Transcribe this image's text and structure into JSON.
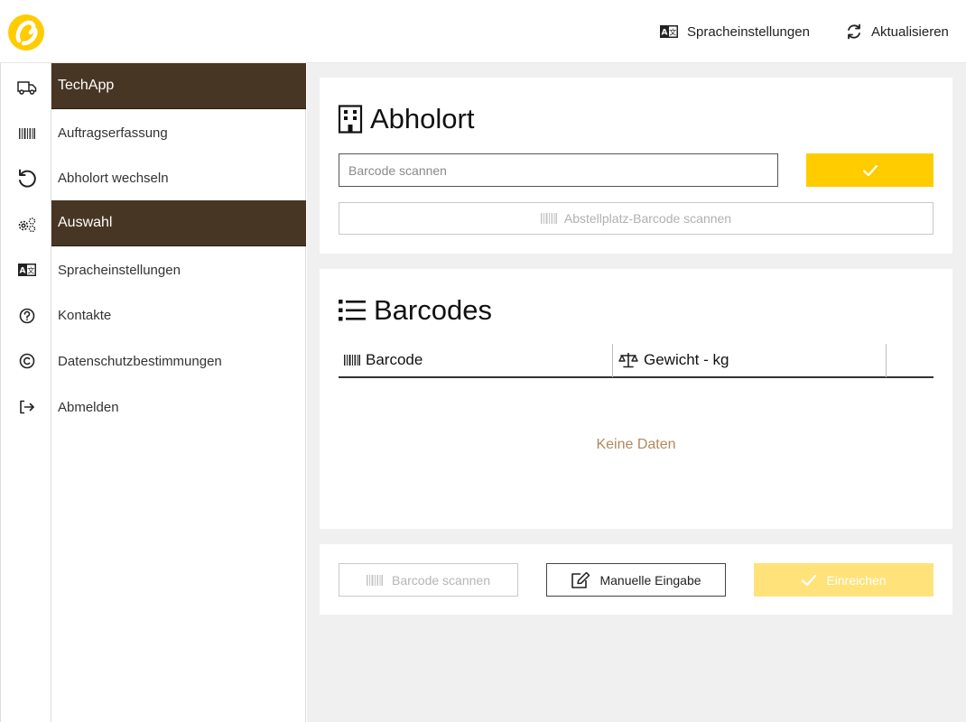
{
  "header": {
    "language_label": "Spracheinstellungen",
    "refresh_label": "Aktualisieren"
  },
  "menu": {
    "items": [
      {
        "label": "TechApp",
        "icon": "truck-icon",
        "header": true
      },
      {
        "label": "Auftragserfassung",
        "icon": "barcode-icon",
        "header": false
      },
      {
        "label": "Abholort wechseln",
        "icon": "undo-icon",
        "header": false
      },
      {
        "label": "Auswahl",
        "icon": "gears-icon",
        "header": true
      },
      {
        "label": "Spracheinstellungen",
        "icon": "language-icon",
        "header": false
      },
      {
        "label": "Kontakte",
        "icon": "question-circle-icon",
        "header": false
      },
      {
        "label": "Datenschutzbestimmungen",
        "icon": "copyright-icon",
        "header": false
      },
      {
        "label": "Abmelden",
        "icon": "logout-icon",
        "header": false
      }
    ]
  },
  "pickup": {
    "title": "Abholort",
    "barcode_placeholder": "Barcode scannen",
    "slot_button_label": "Abstellplatz-Barcode scannen"
  },
  "barcodes": {
    "title": "Barcodes",
    "columns": [
      "Barcode",
      "Gewicht - kg"
    ],
    "empty_text": "Keine Daten"
  },
  "actions": {
    "scan_label": "Barcode scannen",
    "manual_label": "Manuelle Eingabe",
    "submit_label": "Einreichen"
  },
  "colors": {
    "brand_yellow": "#ffcc00",
    "header_brown": "#483624",
    "empty_text": "#b08a5a"
  }
}
